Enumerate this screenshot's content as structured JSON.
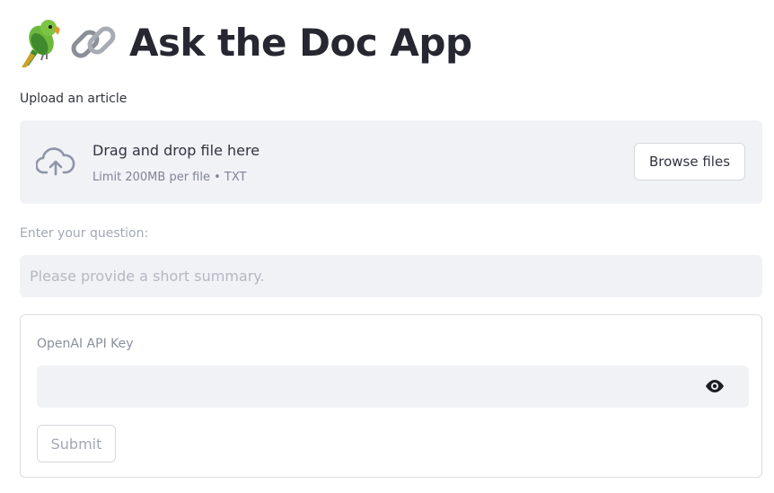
{
  "header": {
    "icons": [
      "parrot-emoji",
      "link-emoji"
    ],
    "title": "Ask the Doc App"
  },
  "uploader": {
    "label": "Upload an article",
    "drop_title": "Drag and drop file here",
    "drop_subtitle": "Limit 200MB per file • TXT",
    "browse_label": "Browse files",
    "icon": "cloud-upload-icon"
  },
  "question": {
    "label": "Enter your question:",
    "value": "",
    "placeholder": "Please provide a short summary."
  },
  "form": {
    "api_key_label": "OpenAI API Key",
    "api_key_value": "",
    "visibility_icon": "eye-icon",
    "submit_label": "Submit"
  },
  "colors": {
    "input_bg": "#f0f2f6",
    "text": "#31333f",
    "muted": "#a3a8b4",
    "border": "#d6d8de"
  }
}
